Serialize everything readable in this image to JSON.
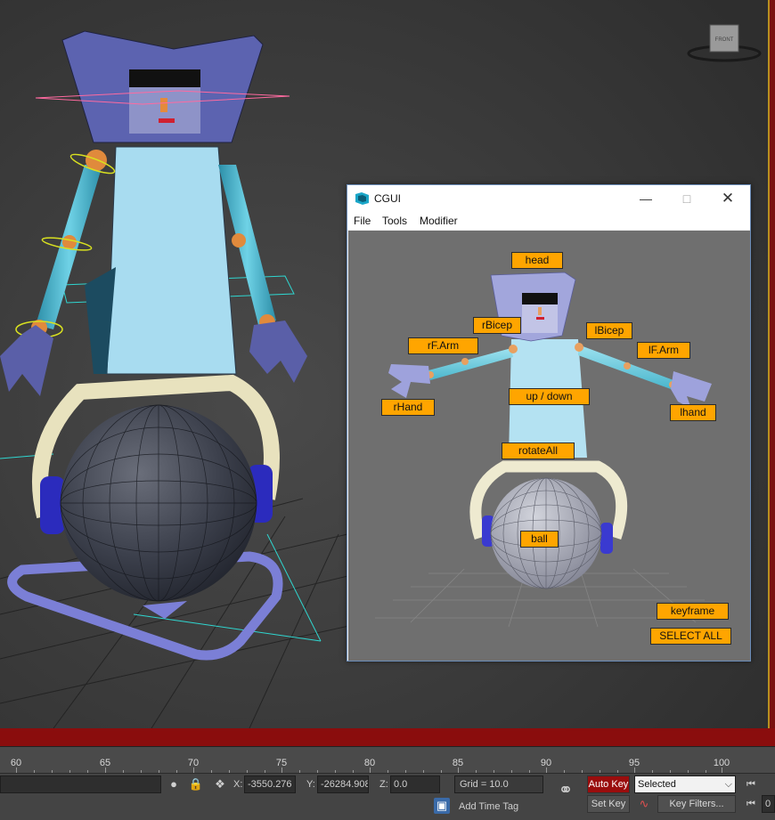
{
  "viewport": {
    "viewcube_label": "FRONT"
  },
  "cgui": {
    "title": "CGUI",
    "menu": [
      "File",
      "Tools",
      "Modifier"
    ],
    "buttons": {
      "head": "head",
      "rBicep": "rBicep",
      "lBicep": "lBicep",
      "rFArm": "rF.Arm",
      "lFArm": "lF.Arm",
      "rHand": "rHand",
      "lhand": "lhand",
      "updown": "up / down",
      "rotateAll": "rotateAll",
      "ball": "ball",
      "keyframe": "keyframe",
      "selectAll": "SELECT ALL"
    },
    "button_color": "#ffa500"
  },
  "timeline": {
    "ticks": [
      "60",
      "65",
      "70",
      "75",
      "80",
      "85",
      "90",
      "95",
      "100"
    ]
  },
  "statusbar": {
    "x_label": "X:",
    "x_value": "-3550.276",
    "y_label": "Y:",
    "y_value": "-26284.908",
    "z_label": "Z:",
    "z_value": "0.0",
    "grid": "Grid = 10.0",
    "add_time_tag": "Add Time Tag",
    "auto_key": "Auto Key",
    "set_key": "Set Key",
    "selected": "Selected",
    "key_filters": "Key Filters...",
    "frame_field": "0"
  },
  "colors": {
    "auto_key_bg": "#9a0d0d",
    "timeline_red": "#8a0d0d"
  }
}
